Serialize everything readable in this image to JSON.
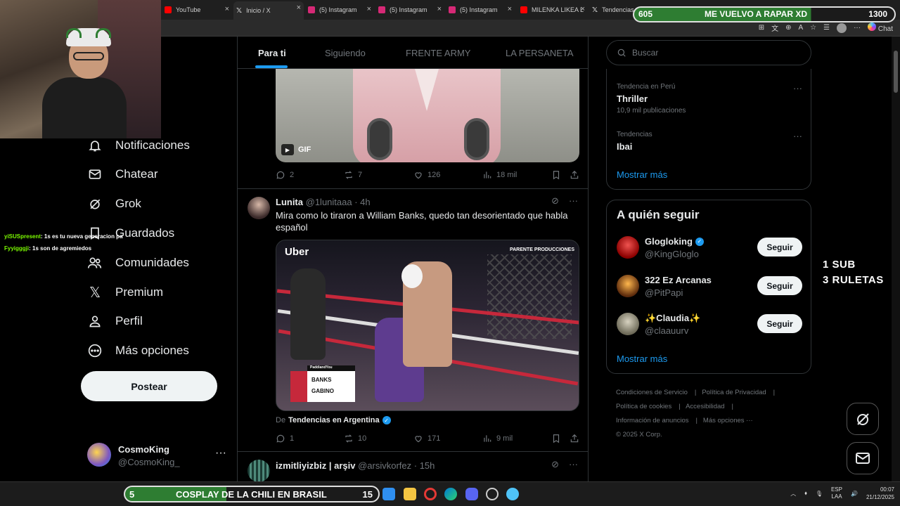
{
  "browser": {
    "tabs": [
      {
        "label": "YouTube",
        "color": "#ff0000"
      },
      {
        "label": "Inicio / X",
        "color": "#ffffff"
      },
      {
        "label": "(5) Instagram",
        "color": "#d62976"
      },
      {
        "label": "(5) Instagram",
        "color": "#d62976"
      },
      {
        "label": "(5) Instagram",
        "color": "#d62976"
      },
      {
        "label": "MILENKA LIKEA L",
        "color": "#ff0000"
      },
      {
        "label": "Tendencias",
        "color": "#ffffff"
      }
    ],
    "chat_label": "Chat"
  },
  "nav": {
    "items": [
      {
        "label": "Notificaciones",
        "icon": "bell-icon"
      },
      {
        "label": "Chatear",
        "icon": "mail-icon"
      },
      {
        "label": "Grok",
        "icon": "grok-icon"
      },
      {
        "label": "Guardados",
        "icon": "bookmark-icon"
      },
      {
        "label": "Comunidades",
        "icon": "people-icon"
      },
      {
        "label": "Premium",
        "icon": "x-logo-icon"
      },
      {
        "label": "Perfil",
        "icon": "person-icon"
      },
      {
        "label": "Más opciones",
        "icon": "more-circle-icon"
      }
    ],
    "post_label": "Postear",
    "account": {
      "name": "CosmoKing",
      "handle": "@CosmoKing_"
    }
  },
  "chat_overlay": [
    {
      "user": "yiSUSpresent",
      "message": ": 1s es tu nueva generacion pa"
    },
    {
      "user": "Fyyigggji",
      "message": ": 1s son de agremiedos"
    }
  ],
  "feed": {
    "tabs": [
      "Para ti",
      "Siguiendo",
      "FRENTE ARMY",
      "LA PERSANETA"
    ],
    "post1": {
      "gif_label": "GIF",
      "replies": "2",
      "reposts": "7",
      "likes": "126",
      "views": "18 mil"
    },
    "post2": {
      "name": "Lunita",
      "handle": "@1lunitaaa",
      "time": "· 4h",
      "text": "Mira como lo tiraron a William Banks, quedo tan desorientado que habla español",
      "media": {
        "brand": "Uber",
        "promo": "PARENTE PRODUCCIONES",
        "fighter1": "BANKS",
        "fighter2": "GABINO",
        "bug_top": "PaddiandYou"
      },
      "source_prefix": "De",
      "source": "Tendencias en Argentina",
      "replies": "1",
      "reposts": "10",
      "likes": "171",
      "views": "9 mil"
    },
    "post3": {
      "name": "izmitliyizbiz | arşiv",
      "handle": "@arsivkorfez",
      "time": "· 15h"
    }
  },
  "sidebar": {
    "search_placeholder": "Buscar",
    "trends": [
      {
        "context": "Tendencia en Perú",
        "title": "Thriller",
        "count": "10,9 mil publicaciones"
      },
      {
        "context": "Tendencias",
        "title": "Ibai",
        "count": ""
      }
    ],
    "show_more": "Mostrar más",
    "who_to_follow": {
      "title": "A quién seguir",
      "items": [
        {
          "name": "Glogloking",
          "handle": "@KingGloglo",
          "verified": true,
          "button": "Seguir",
          "avatar_color": "#c62828"
        },
        {
          "name": "322 Ez Arcanas",
          "handle": "@PitPapi",
          "verified": false,
          "button": "Seguir",
          "avatar_color": "#8d4a1e"
        },
        {
          "name": "✨Claudia✨",
          "handle": "@claauurv",
          "verified": false,
          "button": "Seguir",
          "avatar_color": "#9e9e8a"
        }
      ],
      "show_more": "Mostrar más"
    },
    "footer": [
      "Condiciones de Servicio",
      "Política de Privacidad",
      "Política de cookies",
      "Accesibilidad",
      "Información de anuncios",
      "Más opciones ···",
      "© 2025 X Corp."
    ]
  },
  "overlays": {
    "goal_top": {
      "count": "605",
      "text": "ME VUELVO A RAPAR XD",
      "target": "1300"
    },
    "sub_promo": [
      "1 SUB",
      "3 RULETAS"
    ],
    "goal_bottom": {
      "count": "5",
      "text": "COSPLAY DE LA CHILI EN BRASIL",
      "target": "15"
    }
  },
  "taskbar": {
    "lang": "ESP",
    "lang2": "LAA",
    "time": "00:07",
    "date": "21/12/2025"
  }
}
